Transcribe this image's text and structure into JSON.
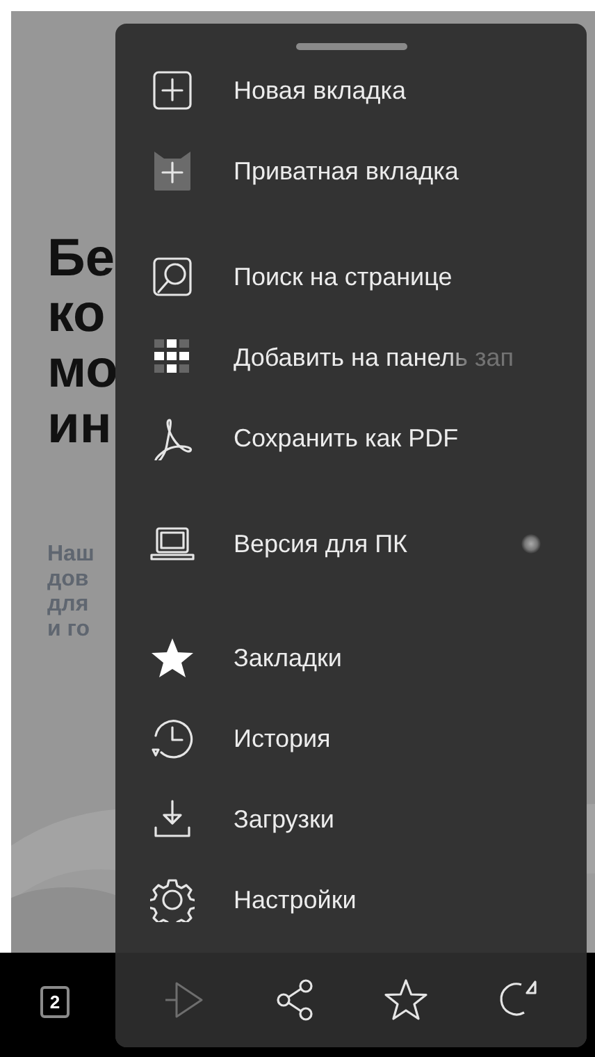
{
  "page": {
    "heading_lines": [
      "Бе",
      "ко",
      "мо",
      "ин"
    ],
    "intro_lines": [
      "Наш",
      "дов",
      "для",
      "и го"
    ]
  },
  "toolbar": {
    "tab_count": "2"
  },
  "menu": {
    "groups": [
      [
        {
          "label": "Новая вкладка"
        },
        {
          "label": "Приватная вкладка"
        }
      ],
      [
        {
          "label": "Поиск на странице"
        },
        {
          "label": "Добавить на панель зап"
        },
        {
          "label": "Сохранить как PDF"
        }
      ],
      [
        {
          "label": "Версия для ПК"
        }
      ],
      [
        {
          "label": "Закладки"
        },
        {
          "label": "История"
        },
        {
          "label": "Загрузки"
        },
        {
          "label": "Настройки"
        }
      ]
    ],
    "actions": [
      {
        "disabled": true
      },
      {
        "disabled": false
      },
      {
        "disabled": false
      },
      {
        "disabled": false
      }
    ]
  }
}
